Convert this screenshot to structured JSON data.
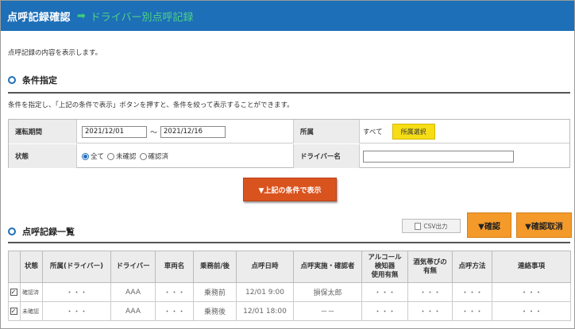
{
  "header": {
    "title": "点呼記録確認",
    "arrow": "➡",
    "subtitle": "ドライバー別点呼記録"
  },
  "intro": "点呼記録の内容を表示します。",
  "conditions": {
    "section_title": "条件指定",
    "description": "条件を指定し、「上記の条件で表示」ボタンを押すと、条件を絞って表示することができます。",
    "period_label": "運転期間",
    "date_from": "2021/12/01",
    "tilde": "～",
    "date_to": "2021/12/16",
    "affiliation_label": "所属",
    "affiliation_value": "すべて",
    "affiliation_button": "所属選択",
    "status_label": "状態",
    "status_options": [
      "全て",
      "未確認",
      "確認済"
    ],
    "status_selected": "全て",
    "driver_label": "ドライバー名",
    "driver_value": "",
    "search_button": "▼上記の条件で表示"
  },
  "list": {
    "section_title": "点呼記録一覧",
    "csv_button": "CSV出力",
    "confirm_button": "▼確認",
    "cancel_button": "▼確認取消",
    "columns": [
      "",
      "状態",
      "所属(ドライバー)",
      "ドライバー",
      "車両名",
      "乗務前/後",
      "点呼日時",
      "点呼実施・確認者",
      "アルコール検知器使用有無",
      "酒気帯びの有無",
      "点呼方法",
      "連絡事項"
    ],
    "column_lines": {
      "alcohol": [
        "アルコール",
        "検知器",
        "使用有無"
      ],
      "drunk": [
        "酒気帯びの",
        "有無"
      ]
    },
    "rows": [
      {
        "checked": "✓",
        "status": "確認済",
        "affiliation": "・・・",
        "driver": "AAA",
        "vehicle": "・・・",
        "timing": "乗務前",
        "datetime": "12/01 9:00",
        "confirmer": "損保太郎",
        "alcohol": "・・・",
        "drunk": "・・・",
        "method": "・・・",
        "notes": "・・・"
      },
      {
        "checked": "✓",
        "status": "未確認",
        "affiliation": "・・・",
        "driver": "AAA",
        "vehicle": "・・・",
        "timing": "乗務後",
        "datetime": "12/01 18:00",
        "confirmer": "－－",
        "alcohol": "・・・",
        "drunk": "・・・",
        "method": "・・・",
        "notes": "・・・"
      }
    ]
  },
  "colors": {
    "header_bg": "#1d6fb8",
    "accent_green": "#4fd286",
    "search_button": "#d9531e",
    "action_button": "#f39a2b",
    "select_button": "#f6dd16"
  }
}
